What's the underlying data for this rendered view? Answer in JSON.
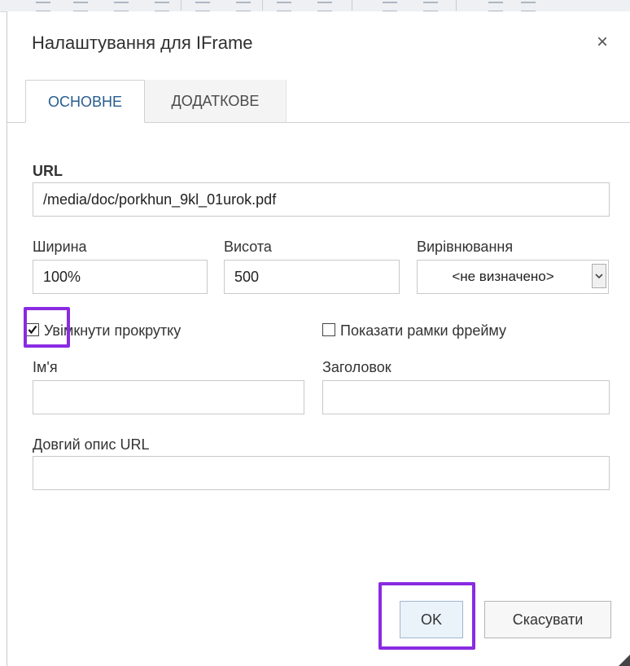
{
  "dialog": {
    "title": "Налаштування для IFrame",
    "close_symbol": "×"
  },
  "tabs": [
    {
      "label": "ОСНОВНЕ",
      "active": true
    },
    {
      "label": "ДОДАТКОВЕ",
      "active": false
    }
  ],
  "form": {
    "url": {
      "label": "URL",
      "value": "/media/doc/porkhun_9kl_01urok.pdf"
    },
    "width": {
      "label": "Ширина",
      "value": "100%"
    },
    "height": {
      "label": "Висота",
      "value": "500"
    },
    "align": {
      "label": "Вирівнювання",
      "selected": "<не визначено>"
    },
    "scrolling": {
      "label": "Увімкнути прокрутку",
      "checked": true
    },
    "frame_border": {
      "label": "Показати рамки фрейму",
      "checked": false
    },
    "name": {
      "label": "Ім'я",
      "value": ""
    },
    "title": {
      "label": "Заголовок",
      "value": ""
    },
    "long_desc": {
      "label": "Довгий опис URL",
      "value": ""
    }
  },
  "buttons": {
    "ok": "OK",
    "cancel": "Скасувати"
  },
  "colors": {
    "highlight": "#8a2be2",
    "active_tab_text": "#285d8f"
  },
  "icons": [
    "close-icon",
    "checkmark-icon",
    "chevron-down-icon",
    "resize-grip-icon"
  ]
}
